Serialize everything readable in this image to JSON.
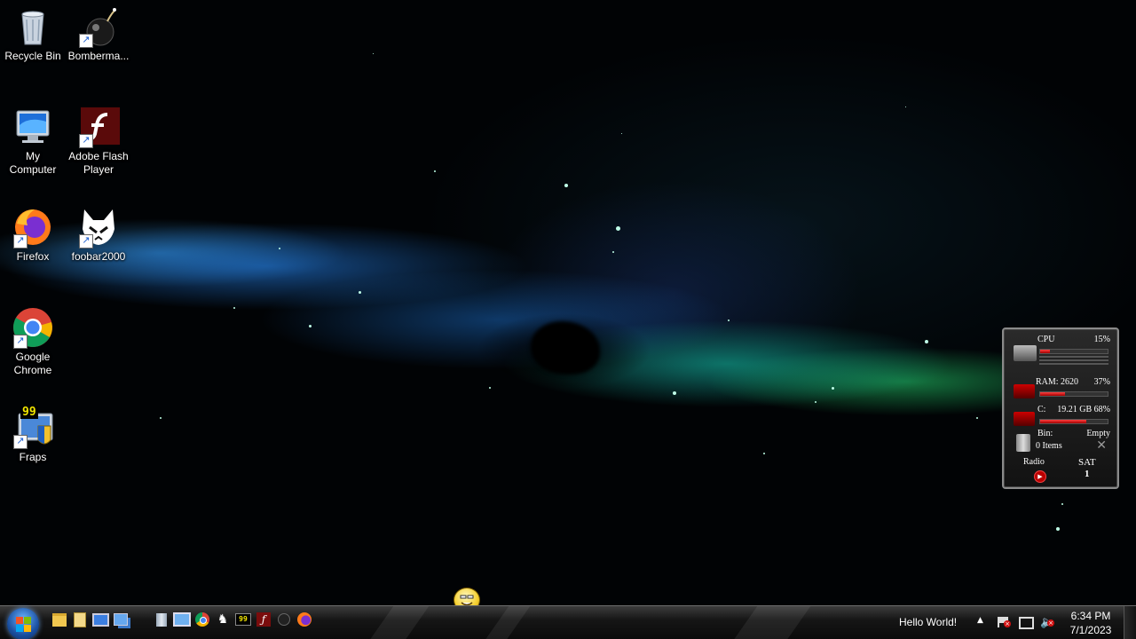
{
  "desktop": {
    "icons": [
      {
        "label": "Recycle Bin",
        "icon": "recycle-bin-icon"
      },
      {
        "label": "Bomberma...",
        "icon": "bomb-icon"
      },
      {
        "label": "My Computer",
        "icon": "my-computer-icon"
      },
      {
        "label": "Adobe Flash Player",
        "icon": "flash-player-icon"
      },
      {
        "label": "Firefox",
        "icon": "firefox-icon"
      },
      {
        "label": "foobar2000",
        "icon": "foobar2000-icon"
      },
      {
        "label": "Google Chrome",
        "icon": "chrome-icon"
      },
      {
        "label": "Fraps",
        "icon": "fraps-icon"
      }
    ],
    "fraps_badge": "99"
  },
  "gadget": {
    "cpu_label": "CPU",
    "cpu_value": "15%",
    "cpu_percent": 15,
    "ram_label": "RAM: 2620",
    "ram_value": "37%",
    "ram_percent": 37,
    "disk_label": "C:",
    "disk_value": "19.21 GB 68%",
    "disk_percent": 68,
    "bin_label": "Bin:",
    "bin_status": "Empty",
    "bin_items": "0 Items",
    "radio_label": "Radio",
    "day_label": "SAT",
    "day_number": "1"
  },
  "taskbar": {
    "quick_launch": [
      "folder-icon",
      "documents-icon",
      "computer-icon",
      "network-icon",
      "recycle-bin-icon",
      "remote-desktop-icon",
      "chrome-icon",
      "foobar2000-icon",
      "fraps-icon",
      "flash-player-icon",
      "bomb-icon",
      "firefox-icon"
    ],
    "tray_text": "Hello World!",
    "time": "6:34 PM",
    "date": "7/1/2023"
  },
  "colors": {
    "gadget_accent": "#d01010",
    "taskbar_bg": "#161616",
    "nebula_blue": "#2f8cff",
    "nebula_green": "#28e678"
  }
}
